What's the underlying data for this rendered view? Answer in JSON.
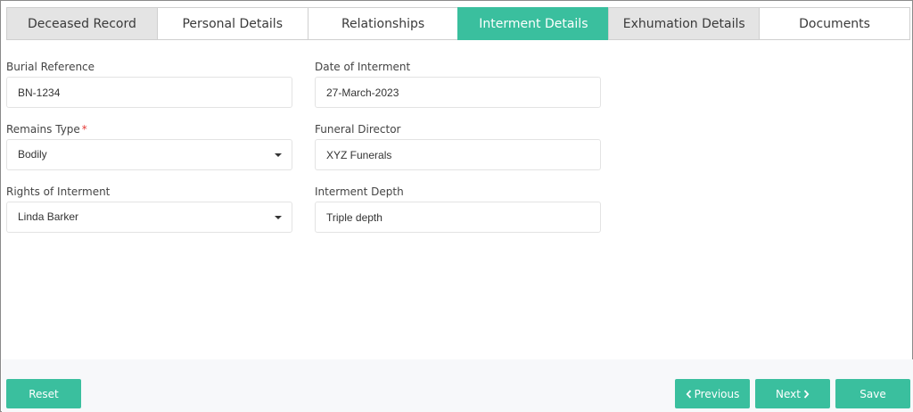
{
  "tabs": [
    {
      "label": "Deceased Record",
      "state": "inactive-grey"
    },
    {
      "label": "Personal Details",
      "state": "inactive"
    },
    {
      "label": "Relationships",
      "state": "inactive"
    },
    {
      "label": "Interment Details",
      "state": "active"
    },
    {
      "label": "Exhumation Details",
      "state": "inactive-grey"
    },
    {
      "label": "Documents",
      "state": "inactive"
    }
  ],
  "form": {
    "burial_reference": {
      "label": "Burial Reference",
      "value": "BN-1234"
    },
    "date_of_interment": {
      "label": "Date of Interment",
      "value": "27-March-2023"
    },
    "remains_type": {
      "label": "Remains Type",
      "required_mark": "*",
      "value": "Bodily"
    },
    "funeral_director": {
      "label": "Funeral Director",
      "value": "XYZ Funerals"
    },
    "rights_of_interment": {
      "label": "Rights of Interment",
      "value": "Linda Barker"
    },
    "interment_depth": {
      "label": "Interment Depth",
      "value": "Triple depth"
    }
  },
  "footer": {
    "reset_label": "Reset",
    "previous_label": "Previous",
    "next_label": "Next",
    "save_label": "Save"
  },
  "colors": {
    "accent": "#3abf9e",
    "tab_grey": "#e4e4e4",
    "required": "#e53935"
  },
  "icons": {
    "previous": "chevron-left-icon",
    "next": "chevron-right-icon",
    "dropdown": "caret-down-icon"
  }
}
